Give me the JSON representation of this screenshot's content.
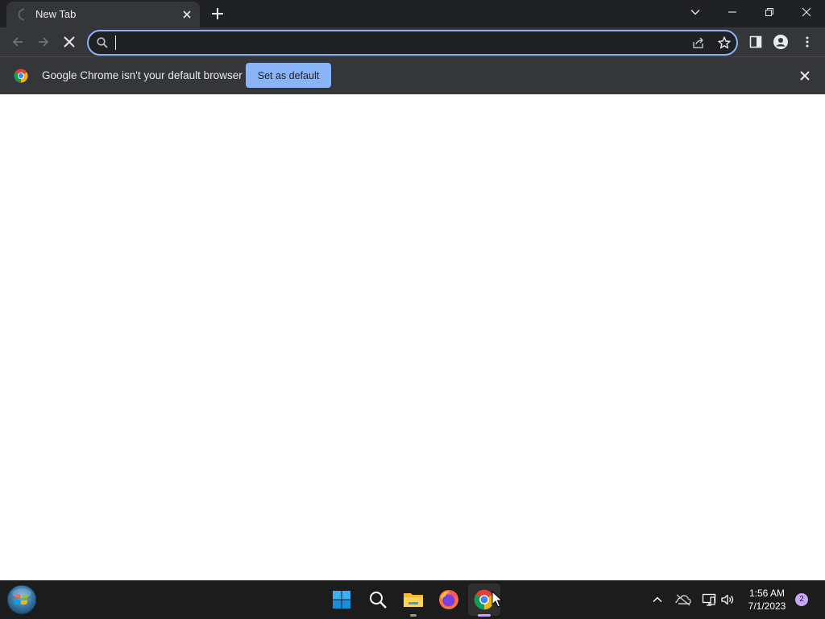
{
  "browser": {
    "tab": {
      "title": "New Tab",
      "close_icon": "close-icon",
      "loading_icon": "spinner-icon"
    },
    "new_tab_icon": "plus-icon",
    "window_controls": [
      "chevron-down-icon",
      "minimize-icon",
      "restore-icon",
      "close-icon"
    ],
    "toolbar": {
      "back_icon": "arrow-left-icon",
      "forward_icon": "arrow-right-icon",
      "stop_icon": "close-icon",
      "omnibox": {
        "value": "",
        "placeholder": ""
      },
      "omnibox_icons": [
        "search-icon",
        "share-icon",
        "star-icon"
      ],
      "right_icons": [
        "side-panel-icon",
        "profile-icon",
        "more-vert-icon"
      ]
    },
    "infobar": {
      "message": "Google Chrome isn't your default browser",
      "button_label": "Set as default"
    }
  },
  "taskbar": {
    "pinned": [
      "windows-start-icon",
      "search-icon",
      "file-explorer-icon",
      "firefox-icon",
      "chrome-icon"
    ],
    "tray_icons": [
      "chevron-up-icon",
      "onedrive-icon",
      "network-icon",
      "volume-icon"
    ],
    "clock": {
      "time": "1:56 AM",
      "date": "7/1/2023"
    },
    "notification_count": "2"
  },
  "colors": {
    "tabstrip_bg": "#202124",
    "toolbar_bg": "#35363a",
    "accent": "#8ab4f8",
    "taskbar_bg": "#1c1c1c"
  }
}
